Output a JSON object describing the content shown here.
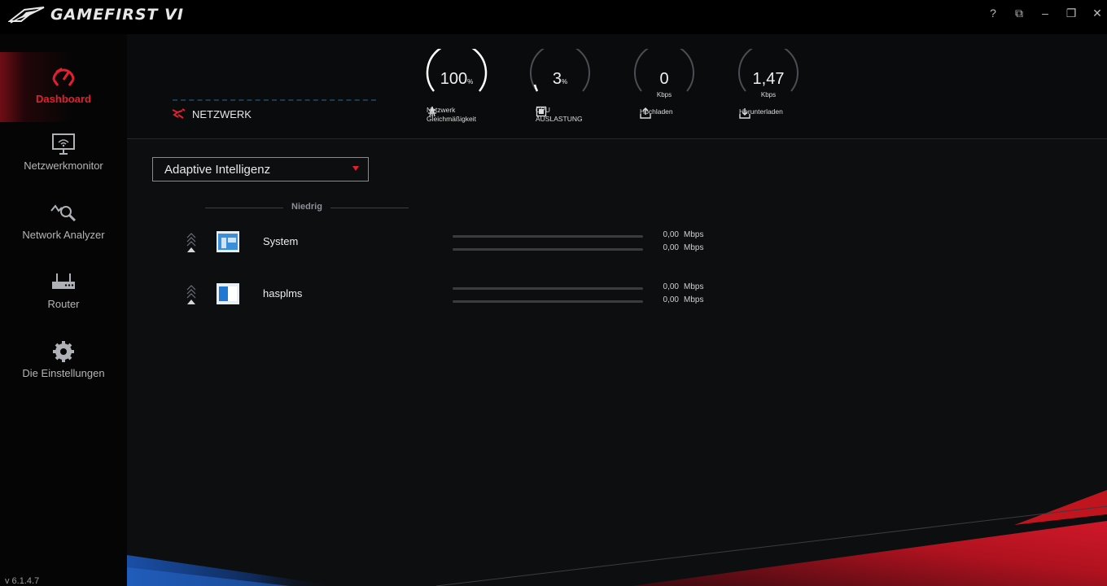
{
  "app": {
    "title": "GAMEFIRST VI",
    "version": "v 6.1.4.7"
  },
  "window_controls": [
    {
      "name": "help",
      "glyph": "?"
    },
    {
      "name": "restore-window",
      "glyph": "⧉"
    },
    {
      "name": "minimize",
      "glyph": "–"
    },
    {
      "name": "maximize",
      "glyph": "❐"
    },
    {
      "name": "close",
      "glyph": "✕"
    }
  ],
  "sidebar": {
    "items": [
      {
        "label": "Dashboard",
        "icon": "dashboard-icon",
        "active": true
      },
      {
        "label": "Netzwerkmonitor",
        "icon": "monitor-wifi-icon",
        "active": false
      },
      {
        "label": "Network Analyzer",
        "icon": "analyzer-icon",
        "active": false
      },
      {
        "label": "Router",
        "icon": "router-icon",
        "active": false
      },
      {
        "label": "Die Einstellungen",
        "icon": "gear-icon",
        "active": false
      }
    ]
  },
  "header": {
    "network_label": "NETZWERK",
    "gauges": [
      {
        "value": "100",
        "unit_suffix": "%",
        "caption": "Netzwerk Gleichmäßigkeit",
        "caption_line1": "Netzwerk",
        "caption_line2": "Gleichmäßigkeit",
        "fraction": 1.0
      },
      {
        "value": "3",
        "unit_suffix": "%",
        "caption_line1": "CPU",
        "caption_line2": "AUSLASTUNG",
        "fraction": 0.03
      },
      {
        "value": "0",
        "unit": "Kbps",
        "caption_line1": "Hochladen",
        "caption_line2": "",
        "fraction": 0.0
      },
      {
        "value": "1,47",
        "unit": "Kbps",
        "caption_line1": "Herunterladen",
        "caption_line2": "",
        "fraction": 0.0
      }
    ]
  },
  "mode_select": {
    "value": "Adaptive Intelligenz"
  },
  "group": {
    "label": "Niedrig"
  },
  "apps": [
    {
      "name": "System",
      "up_value": "0,00",
      "down_value": "0,00",
      "unit": "Mbps",
      "up_fraction": 0.0,
      "down_fraction": 0.0
    },
    {
      "name": "hasplms",
      "up_value": "0,00",
      "down_value": "0,00",
      "unit": "Mbps",
      "up_fraction": 0.0,
      "down_fraction": 0.0
    }
  ],
  "colors": {
    "accent": "#e2202f",
    "background": "#0d0e10",
    "sidebar": "#050505",
    "gauge_arc": "#ffffff",
    "gauge_track": "#4a4d52"
  }
}
